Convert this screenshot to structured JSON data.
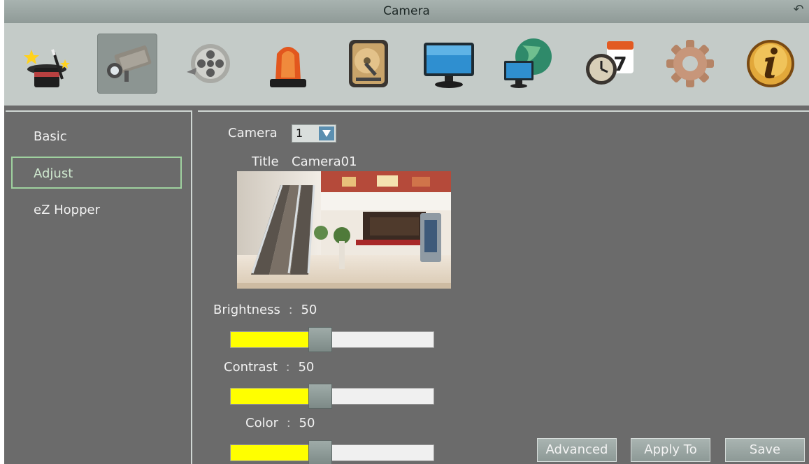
{
  "window": {
    "title": "Camera"
  },
  "toolbar": {
    "items": [
      {
        "icon": "wizard-icon",
        "label": "Wizard"
      },
      {
        "icon": "camera-icon",
        "label": "Camera",
        "active": true
      },
      {
        "icon": "record-icon",
        "label": "Record"
      },
      {
        "icon": "alarm-icon",
        "label": "Alarm"
      },
      {
        "icon": "storage-icon",
        "label": "Storage"
      },
      {
        "icon": "display-icon",
        "label": "Display"
      },
      {
        "icon": "network-icon",
        "label": "Network"
      },
      {
        "icon": "schedule-icon",
        "label": "Schedule"
      },
      {
        "icon": "settings-icon",
        "label": "Settings"
      },
      {
        "icon": "info-icon",
        "label": "Info"
      }
    ]
  },
  "sidebar": {
    "items": [
      {
        "label": "Basic"
      },
      {
        "label": "Adjust",
        "selected": true
      },
      {
        "label": "eZ Hopper"
      }
    ]
  },
  "main": {
    "camera_label": "Camera",
    "camera_value": "1",
    "title_label": "Title",
    "title_value": "Camera01",
    "brightness": {
      "label": "Brightness",
      "sep": ":",
      "value": "50",
      "level_percent": 44
    },
    "contrast": {
      "label": "Contrast",
      "sep": ":",
      "value": "50",
      "level_percent": 44
    },
    "color": {
      "label": "Color",
      "sep": ":",
      "value": "50",
      "level_percent": 44
    }
  },
  "buttons": {
    "advanced": "Advanced",
    "apply_to": "Apply To",
    "save": "Save"
  },
  "colors": {
    "slider_fill": "#ffff00",
    "selected_border": "#9fd19f",
    "background": "#6b6b6b"
  }
}
